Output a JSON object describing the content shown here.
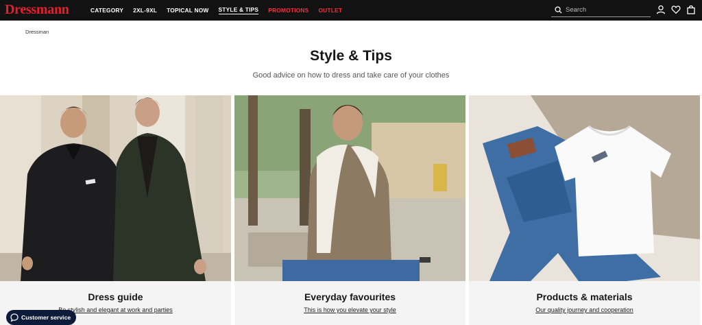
{
  "header": {
    "logo": "Dressmann",
    "nav": [
      {
        "label": "CATEGORY"
      },
      {
        "label": "2XL-9XL"
      },
      {
        "label": "TOPICAL NOW"
      },
      {
        "label": "STYLE & TIPS"
      },
      {
        "label": "PROMOTIONS"
      },
      {
        "label": "OUTLET"
      }
    ],
    "search_placeholder": "Search",
    "icons": [
      "search-icon",
      "account-icon",
      "heart-icon",
      "bag-icon"
    ],
    "colors": {
      "bar": "#121212",
      "brand": "#e2212d",
      "promo": "#f0333f"
    }
  },
  "breadcrumb": "Dressman",
  "page": {
    "title": "Style & Tips",
    "subtitle": "Good advice on how to dress and take care of your clothes"
  },
  "cards": [
    {
      "title": "Dress guide",
      "link": "Be stylish and elegant at work and parties"
    },
    {
      "title": "Everyday favourites",
      "link": "This is how you elevate your style"
    },
    {
      "title": "Products & materials",
      "link": "Our quality journey and cooperation"
    }
  ],
  "customer_service": {
    "label": "Customer service",
    "icon": "chat-icon",
    "color": "#0d1b3a"
  }
}
